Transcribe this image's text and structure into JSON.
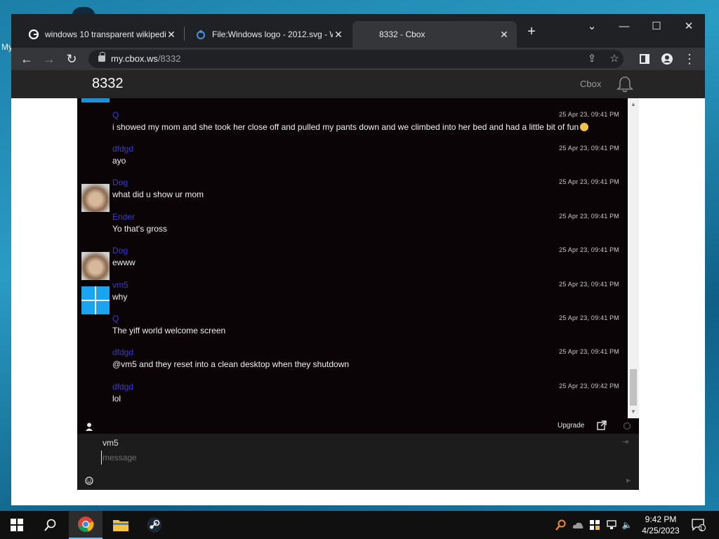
{
  "desktop": {
    "icon_label": "My"
  },
  "browser": {
    "tabs": [
      {
        "title": "windows 10 transparent wikipedi",
        "icon": "google-icon"
      },
      {
        "title": "File:Windows logo - 2012.svg - W",
        "icon": "wikimedia-icon"
      },
      {
        "title": "8332 - Cbox",
        "icon": "cbox-icon",
        "active": true
      }
    ],
    "url_host": "my.cbox.ws",
    "url_path": "/8332"
  },
  "cbox": {
    "title": "8332",
    "brand": "Cbox",
    "messages": [
      {
        "name": "Q",
        "time": "25 Apr 23, 09:41 PM",
        "text": "i showed my mom and she took her close off and pulled my pants down and we climbed into her bed and had a little bit of fun",
        "avatar": "none",
        "emoji": true
      },
      {
        "name": "dfdgd",
        "time": "25 Apr 23, 09:41 PM",
        "text": "ayo",
        "avatar": "none"
      },
      {
        "name": "Dog",
        "time": "25 Apr 23, 09:41 PM",
        "text": "what did u show ur mom",
        "avatar": "dog"
      },
      {
        "name": "Ender",
        "time": "25 Apr 23, 09:41 PM",
        "text": "Yo that's gross",
        "avatar": "none"
      },
      {
        "name": "Dog",
        "time": "25 Apr 23, 09:41 PM",
        "text": "ewww",
        "avatar": "dog"
      },
      {
        "name": "vm5",
        "time": "25 Apr 23, 09:41 PM",
        "text": "why",
        "avatar": "windows"
      },
      {
        "name": "Q",
        "time": "25 Apr 23, 09:41 PM",
        "text": "The yiff world welcome screen",
        "avatar": "none"
      },
      {
        "name": "dfdgd",
        "time": "25 Apr 23, 09:41 PM",
        "text": "@vm5 and they reset into a clean desktop when they shutdown",
        "avatar": "none"
      },
      {
        "name": "dfdgd",
        "time": "25 Apr 23, 09:42 PM",
        "text": "lol",
        "avatar": "none"
      }
    ],
    "upgrade_label": "Upgrade",
    "username": "vm5",
    "message_placeholder": "message"
  },
  "taskbar": {
    "time": "9:42 PM",
    "date": "4/25/2023",
    "notification_count": "1"
  },
  "colors": {
    "name_blue": "#3a3ad9",
    "chat_bg": "#0b0406",
    "accent": "#76b9ed"
  }
}
